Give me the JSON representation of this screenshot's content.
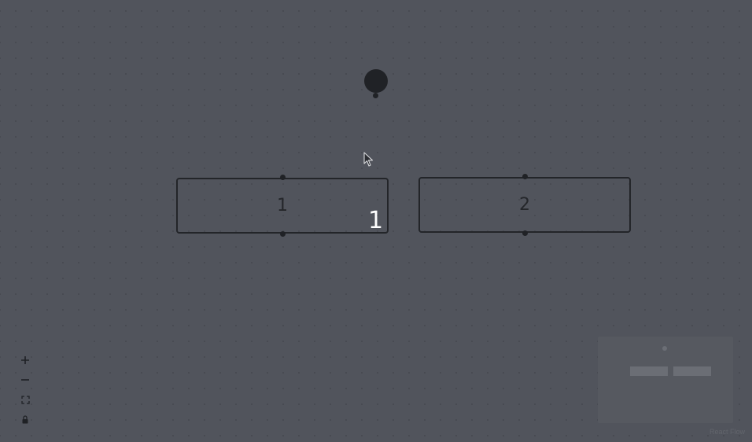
{
  "nodes": [
    {
      "id": "circle",
      "label": ""
    },
    {
      "id": "1",
      "label": "1"
    },
    {
      "id": "2",
      "label": "2"
    }
  ],
  "selection_badge": "1",
  "controls": {
    "zoom_in_icon": "plus-icon",
    "zoom_out_icon": "minus-icon",
    "fit_view_icon": "fit-view-icon",
    "lock_icon": "lock-icon"
  },
  "attribution": "React Flow",
  "colors": {
    "background": "#51545c",
    "node_border": "#232529",
    "handle": "#202226"
  }
}
